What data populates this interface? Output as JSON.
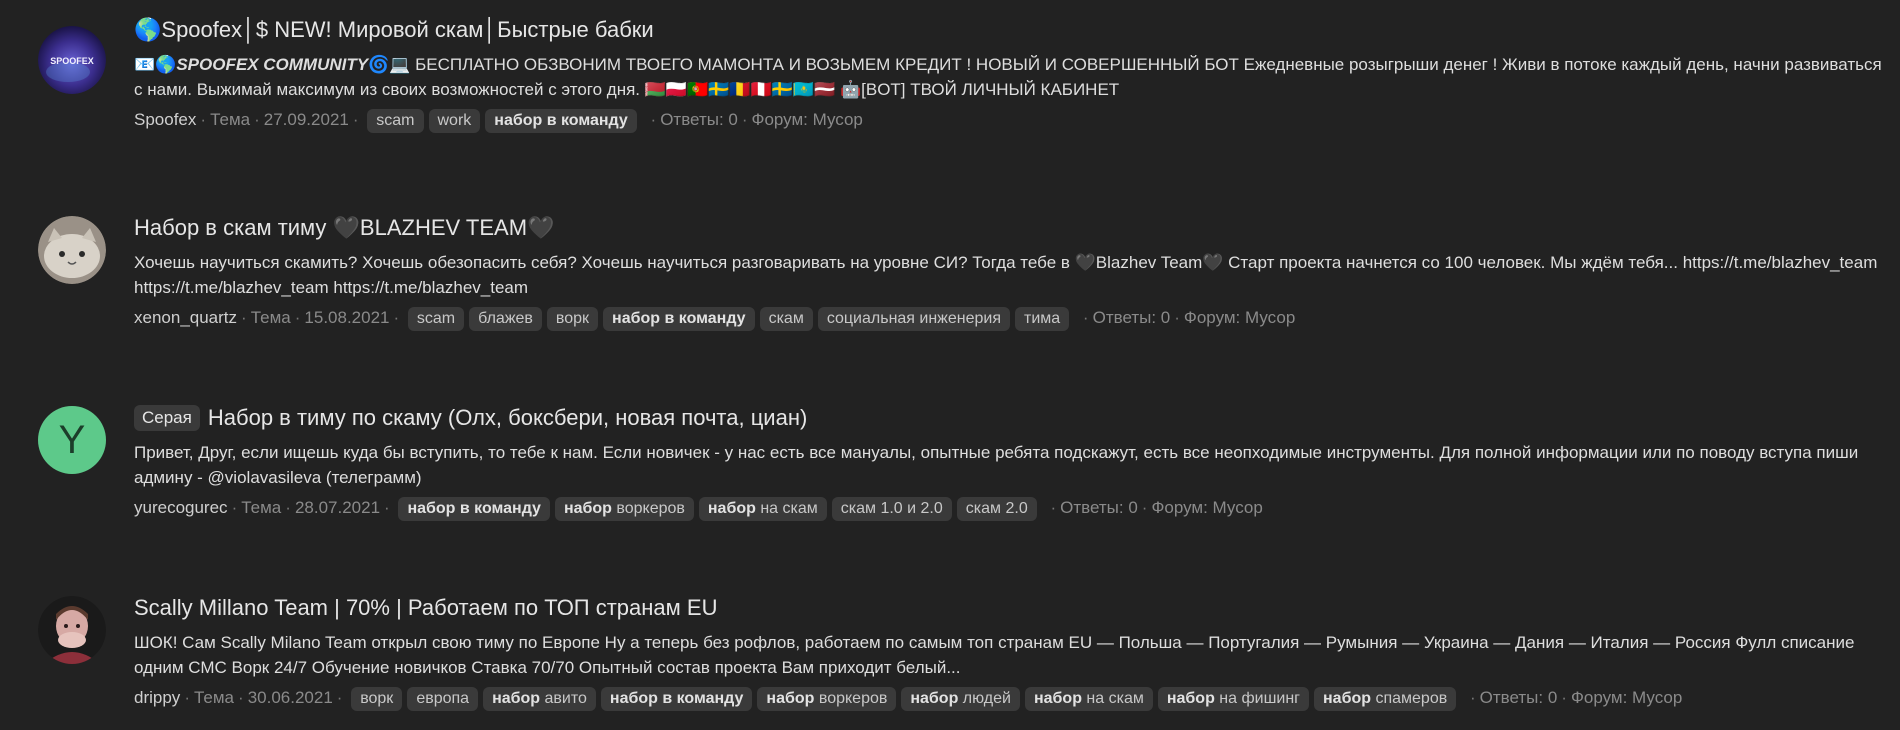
{
  "results": [
    {
      "avatar_text": "SPOOFEX",
      "title": "🌎Spoofex│$ NEW! Мировой скам│Быстрые бабки",
      "snippet_lead": "📧🌎",
      "snippet_brand": "SPOOFEX COMMUNITY",
      "snippet": "🌀💻 БЕСПЛАТНО ОБЗВОНИМ ТВОЕГО МАМОНТА И ВОЗЬМЕМ КРЕДИТ ! НОВЫЙ И СОВЕРШЕННЫЙ БОТ Ежедневные розыгрыши денег ! Живи в потоке каждый день, начни развиваться с нами. Выжимай максимум из своих возможностей с этого дня. 🇧🇾🇵🇱🇵🇹🇸🇪🇷🇴🇵🇪🇸🇪🇰🇿🇱🇻 🤖[BOT] ТВОЙ ЛИЧНЫЙ КАБИНЕТ",
      "author": "Spoofex",
      "type": "Тема",
      "date": "27.09.2021",
      "tags": [
        {
          "bold": "",
          "text": "scam"
        },
        {
          "bold": "",
          "text": "work"
        },
        {
          "bold": "набор в команду",
          "text": ""
        }
      ],
      "replies": "Ответы: 0",
      "forum": "Форум: Мусор"
    },
    {
      "title": "Набор в скам тиму 🖤BLAZHEV TEAM🖤",
      "snippet": "Хочешь научиться скамить? Хочешь обезопасить себя? Хочешь научиться разговаривать на уровне СИ? Тогда тебе в 🖤Blazhev Team🖤 Старт проекта начнется со 100 человек. Мы ждём тебя... https://t.me/blazhev_team https://t.me/blazhev_team https://t.me/blazhev_team",
      "author": "xenon_quartz",
      "type": "Тема",
      "date": "15.08.2021",
      "tags": [
        {
          "bold": "",
          "text": "scam"
        },
        {
          "bold": "",
          "text": "блажев"
        },
        {
          "bold": "",
          "text": "ворк"
        },
        {
          "bold": "набор в команду",
          "text": ""
        },
        {
          "bold": "",
          "text": "скам"
        },
        {
          "bold": "",
          "text": "социальная инженерия"
        },
        {
          "bold": "",
          "text": "тима"
        }
      ],
      "replies": "Ответы: 0",
      "forum": "Форум: Мусор"
    },
    {
      "avatar_letter": "Y",
      "prefix": "Серая",
      "title": "Набор в тиму по скаму (Олх, боксбери, новая почта, циан)",
      "snippet": "Привет, Друг, если ищешь куда бы вступить, то тебе к нам. Если новичек - у нас есть все мануалы, опытные ребята подскажут, есть все неопходимые инструменты. Для полной информации или по поводу вступа пиши админу - @violavasileva (телеграмм)",
      "author": "yurecogurec",
      "type": "Тема",
      "date": "28.07.2021",
      "tags": [
        {
          "bold": "набор в команду",
          "text": ""
        },
        {
          "bold": "набор",
          "text": " воркеров"
        },
        {
          "bold": "набор",
          "text": " на скам"
        },
        {
          "bold": "",
          "text": "скам 1.0 и 2.0"
        },
        {
          "bold": "",
          "text": "скам 2.0"
        }
      ],
      "replies": "Ответы: 0",
      "forum": "Форум: Мусор"
    },
    {
      "title": "Scally Millano Team | 70% | Работаем по ТОП странам EU",
      "snippet": "ШОК! Сам Scally Milano Team открыл свою тиму по Европе Ну а теперь без рофлов, работаем по самым топ странам EU — Польша — Португалия — Румыния — Украина — Дания — Италия — Россия Фулл списание одним СМС Ворк 24/7 Обучение новичков Ставка 70/70 Опытный состав проекта Вам приходит белый...",
      "author": "drippy",
      "type": "Тема",
      "date": "30.06.2021",
      "tags": [
        {
          "bold": "",
          "text": "ворк"
        },
        {
          "bold": "",
          "text": "европа"
        },
        {
          "bold": "набор",
          "text": " авито"
        },
        {
          "bold": "набор в команду",
          "text": ""
        },
        {
          "bold": "набор",
          "text": " воркеров"
        },
        {
          "bold": "набор",
          "text": " людей"
        },
        {
          "bold": "набор",
          "text": " на скам"
        },
        {
          "bold": "набор",
          "text": " на фишинг"
        },
        {
          "bold": "набор",
          "text": " спамеров"
        }
      ],
      "replies": "Ответы: 0",
      "forum": "Форум: Мусор"
    }
  ],
  "colors": {
    "background": "#222222",
    "tag_bg": "#3a3a3a",
    "meta_text": "#8a8a8a",
    "avatar_y_bg": "#5dc98a"
  },
  "icons": [
    "spoofex-logo-avatar",
    "cat-avatar",
    "letter-avatar",
    "photo-avatar"
  ]
}
